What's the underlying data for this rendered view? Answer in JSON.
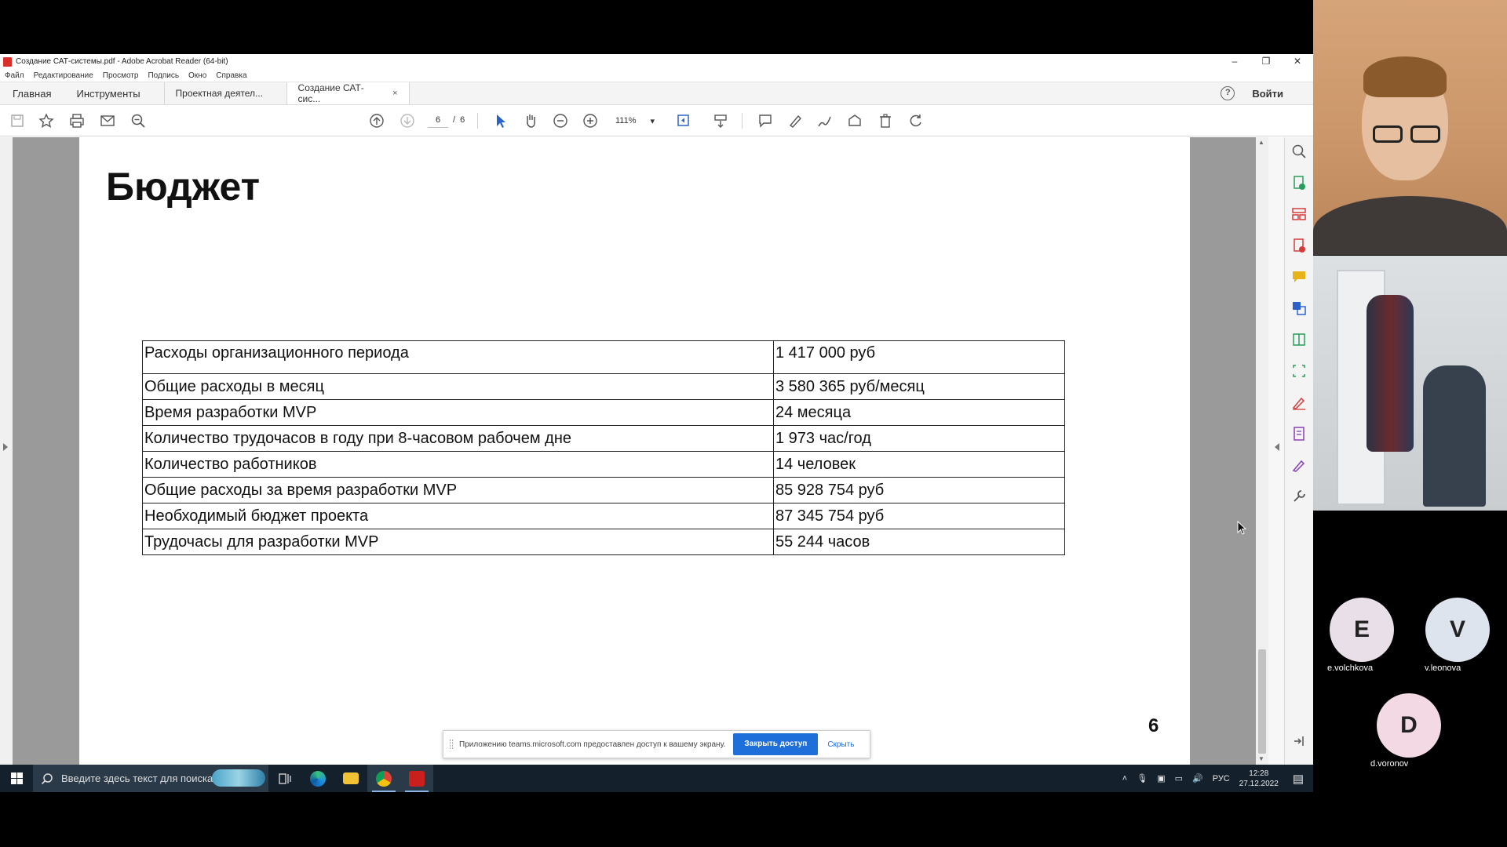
{
  "acrobat": {
    "window_title": "Создание САТ-системы.pdf - Adobe Acrobat Reader (64-bit)",
    "window_controls": [
      "–",
      "❐",
      "✕"
    ],
    "menu": [
      "Файл",
      "Редактирование",
      "Просмотр",
      "Подпись",
      "Окно",
      "Справка"
    ],
    "tabs": {
      "home": "Главная",
      "tools": "Инструменты",
      "doc1": "Проектная деятел...",
      "doc2": "Создание САТ-сис...",
      "close": "×"
    },
    "help": "?",
    "login": "Войти",
    "toolbar": {
      "page_current": "6",
      "page_sep": "/",
      "page_total": "6",
      "zoom": "111%",
      "zoom_caret": "▾"
    },
    "page": {
      "title": "Бюджет",
      "page_number": "6",
      "table": [
        [
          "Расходы организационного периода",
          "1 417 000 руб"
        ],
        [
          "Общие расходы в месяц",
          "3 580 365 руб/месяц"
        ],
        [
          "Время разработки MVP",
          "24 месяца"
        ],
        [
          "Количество трудочасов в году при 8-часовом рабочем дне",
          "1 973 час/год"
        ],
        [
          "Количество работников",
          "14 человек"
        ],
        [
          "Общие расходы за время разработки MVP",
          "85 928 754 руб"
        ],
        [
          "Необходимый бюджет проекта",
          "87 345 754 руб"
        ],
        [
          "Трудочасы для разработки MVP",
          "55 244 часов"
        ]
      ]
    },
    "share_bar": {
      "message": "Приложению teams.microsoft.com предоставлен доступ к вашему экрану.",
      "stop_button": "Закрыть доступ",
      "hide_link": "Скрыть"
    }
  },
  "taskbar": {
    "search_placeholder": "Введите здесь текст для поиска",
    "tray_lang": "РУС",
    "time": "12:28",
    "date": "27.12.2022"
  },
  "teams": {
    "participants": [
      {
        "initial": "E",
        "name": "e.volchkova",
        "color": "#e9dfe9"
      },
      {
        "initial": "V",
        "name": "v.leonova",
        "color": "#dde4ee"
      },
      {
        "initial": "D",
        "name": "d.voronov",
        "color": "#f2d9e4"
      }
    ]
  },
  "colors": {
    "accent_blue": "#1e6fd9",
    "taskbar": "#14202c",
    "toolbar_blue_icon": "#2b62c9"
  }
}
